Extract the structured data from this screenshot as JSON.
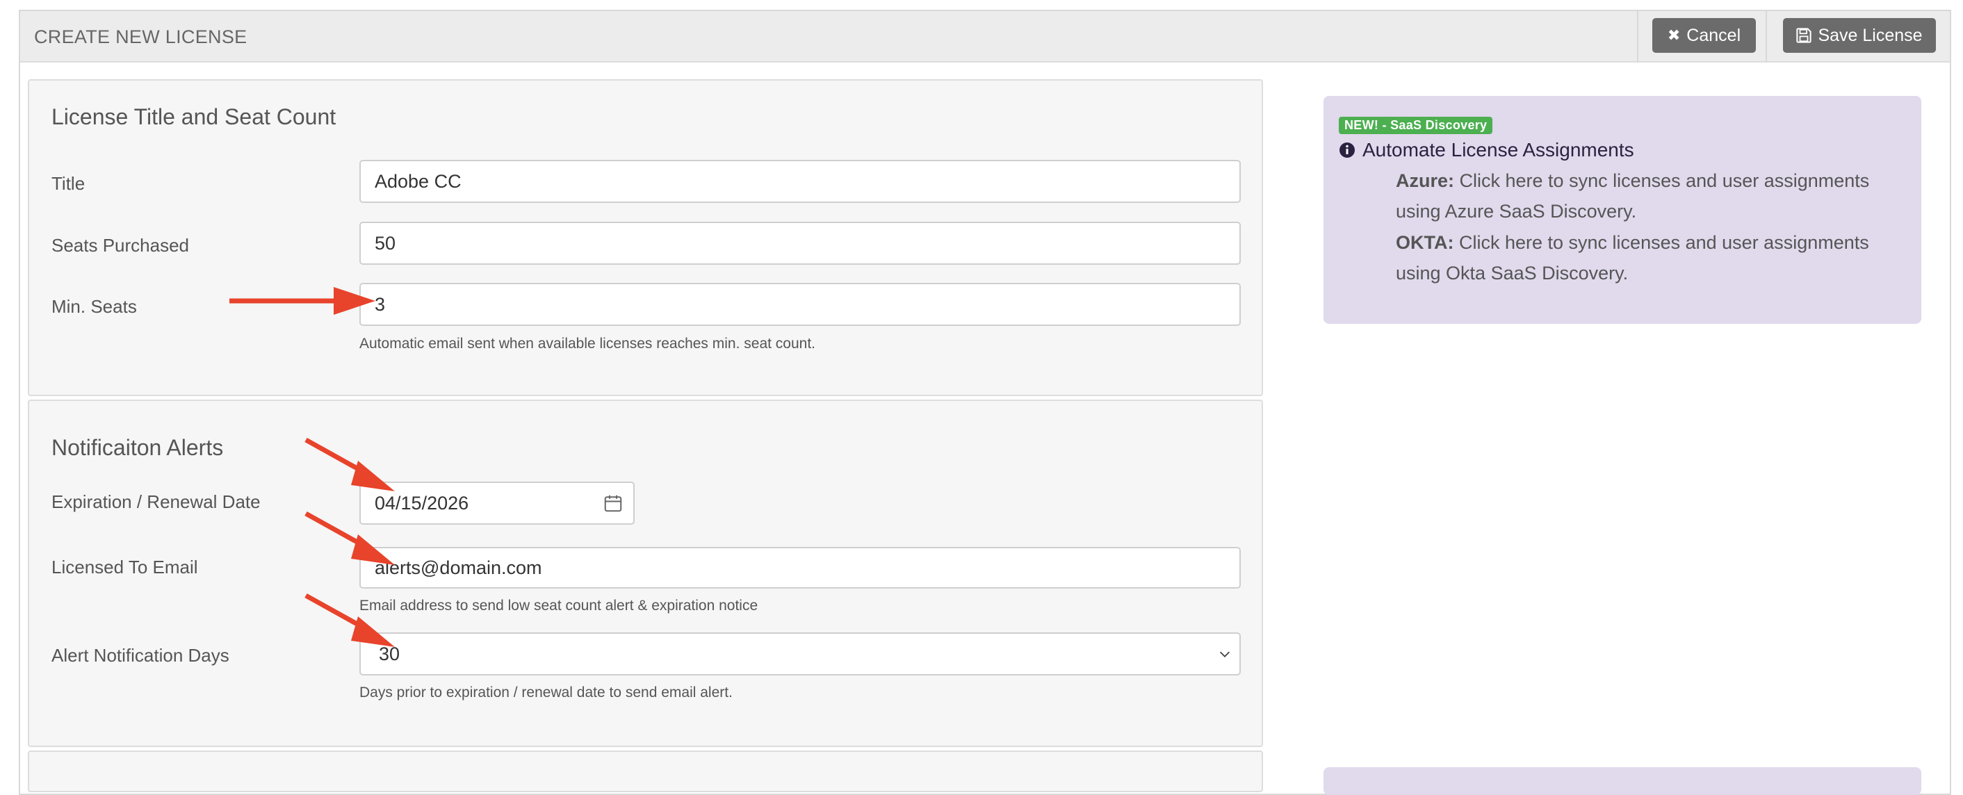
{
  "header": {
    "title": "CREATE NEW LICENSE",
    "cancel_label": "Cancel",
    "save_label": "Save License"
  },
  "section1": {
    "title": "License Title and Seat Count",
    "fields": {
      "title": {
        "label": "Title",
        "value": "Adobe CC"
      },
      "seats_purchased": {
        "label": "Seats Purchased",
        "value": "50"
      },
      "min_seats": {
        "label": "Min. Seats",
        "value": "3",
        "help": "Automatic email sent when available licenses reaches min. seat count."
      }
    }
  },
  "section2": {
    "title": "Notificaiton Alerts",
    "fields": {
      "expiration": {
        "label": "Expiration / Renewal Date",
        "value": "04/15/2026"
      },
      "email": {
        "label": "Licensed To Email",
        "value": "alerts@domain.com",
        "help": "Email address to send low seat count alert & expiration notice"
      },
      "alert_days": {
        "label": "Alert Notification Days",
        "value": "30",
        "help": "Days prior to expiration / renewal date to send email alert."
      }
    }
  },
  "sidebar": {
    "badge": "NEW! - SaaS Discovery",
    "heading": "Automate License Assignments",
    "azure_label": "Azure:",
    "azure_text1": " Click here to sync licenses and user assignments",
    "azure_text2": "using Azure SaaS Discovery.",
    "okta_label": "OKTA:",
    "okta_text1": " Click here to sync licenses and user assignments",
    "okta_text2": "using Okta SaaS Discovery."
  },
  "colors": {
    "arrow": "#e8432b",
    "sidebar_bg": "#e1d9ec",
    "badge": "#4caf50",
    "button": "#6b6b6b"
  },
  "icons": [
    "times-icon",
    "save-icon",
    "calendar-icon",
    "chevron-down-icon",
    "info-circle-icon",
    "arrow-annotation"
  ]
}
